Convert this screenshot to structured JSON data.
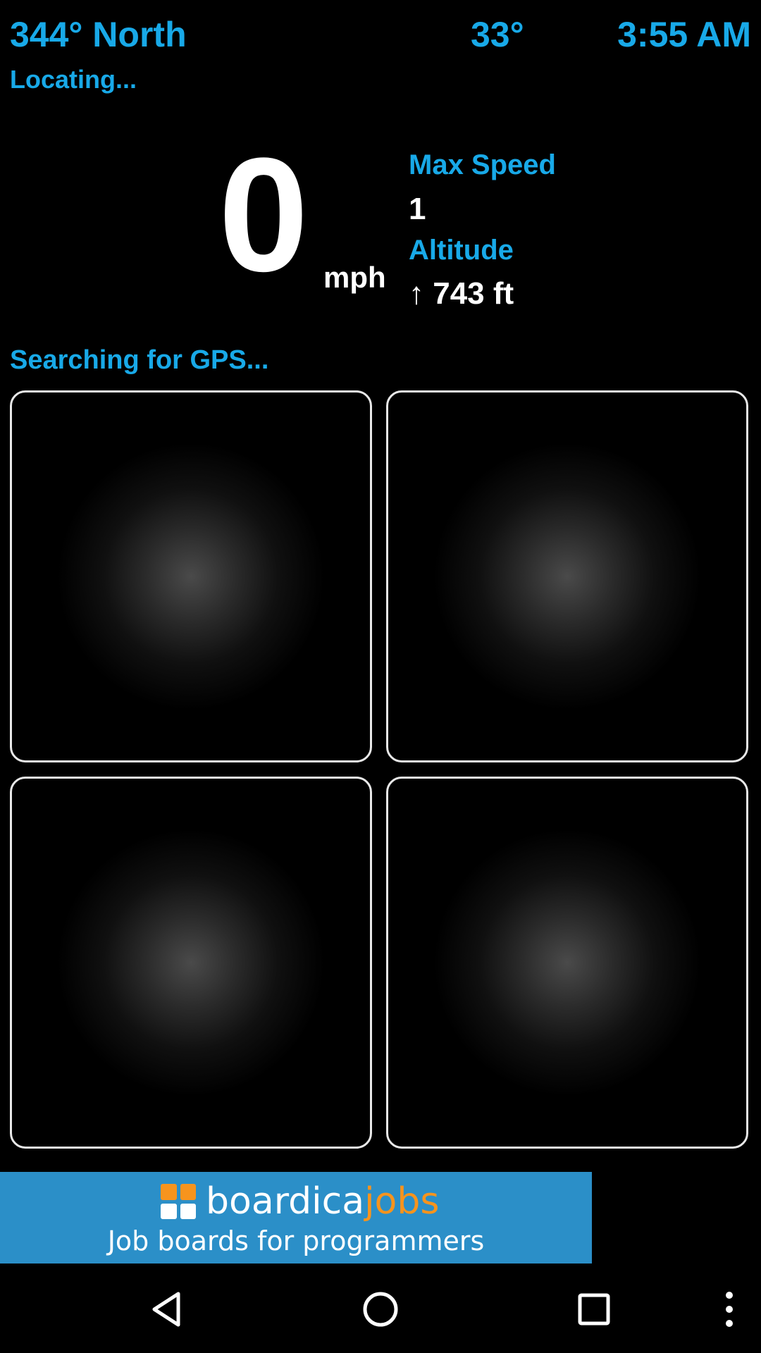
{
  "status": {
    "heading": "344° North",
    "temperature": "33°",
    "time": "3:55 AM",
    "location_status": "Locating..."
  },
  "speed": {
    "value": "0",
    "unit": "mph"
  },
  "stats": {
    "max_speed_label": "Max Speed",
    "max_speed_value": "1",
    "altitude_label": "Altitude",
    "altitude_value": "↑ 743 ft"
  },
  "gps": {
    "status": "Searching for GPS..."
  },
  "ad": {
    "brand": "boardica",
    "brand_accent": "jobs",
    "tagline": "Job boards for programmers"
  },
  "nav": {
    "icons": [
      "back-icon",
      "home-icon",
      "recents-icon",
      "overflow-menu-icon"
    ]
  },
  "colors": {
    "accent": "#18a9e8",
    "ad_background": "#2b8fc8",
    "ad_accent": "#f7941d"
  }
}
